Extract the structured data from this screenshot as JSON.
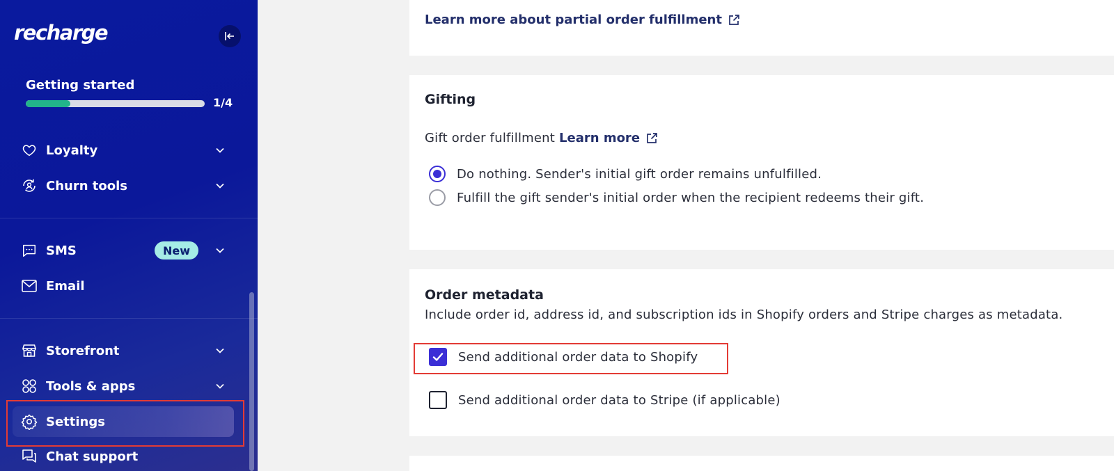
{
  "app": {
    "logo_text": "recharge"
  },
  "sidebar": {
    "getting_started": {
      "title": "Getting started",
      "progress_fraction": 0.25,
      "progress_label": "1/4"
    },
    "items": [
      {
        "label": "Loyalty",
        "icon": "heart-icon",
        "has_chevron": true
      },
      {
        "label": "Churn tools",
        "icon": "churn-icon",
        "has_chevron": true
      },
      {
        "label": "SMS",
        "icon": "message-icon",
        "has_chevron": true,
        "badge": "New"
      },
      {
        "label": "Email",
        "icon": "envelope-icon",
        "has_chevron": false
      },
      {
        "label": "Storefront",
        "icon": "storefront-icon",
        "has_chevron": true
      },
      {
        "label": "Tools & apps",
        "icon": "apps-icon",
        "has_chevron": true
      },
      {
        "label": "Settings",
        "icon": "gear-icon",
        "has_chevron": false,
        "active": true
      },
      {
        "label": "Chat support",
        "icon": "chat-icon",
        "has_chevron": false
      }
    ]
  },
  "main": {
    "partial_link": "Learn more about partial order fulfillment",
    "gifting": {
      "title": "Gifting",
      "fulfillment_label": "Gift order fulfillment",
      "learn_more": "Learn more",
      "options": [
        {
          "label": "Do nothing. Sender's initial gift order remains unfulfilled.",
          "selected": true
        },
        {
          "label": "Fulfill the gift sender's initial order when the recipient redeems their gift.",
          "selected": false
        }
      ]
    },
    "order_metadata": {
      "title": "Order metadata",
      "description": "Include order id, address id, and subscription ids in Shopify orders and Stripe charges as metadata.",
      "options": [
        {
          "label": "Send additional order data to Shopify",
          "checked": true
        },
        {
          "label": "Send additional order data to Stripe (if applicable)",
          "checked": false
        }
      ]
    }
  },
  "colors": {
    "sidebar_bg": "#0b189a",
    "accent": "#3b2fd6",
    "progress": "#22b48a",
    "highlight": "#e33b35"
  }
}
